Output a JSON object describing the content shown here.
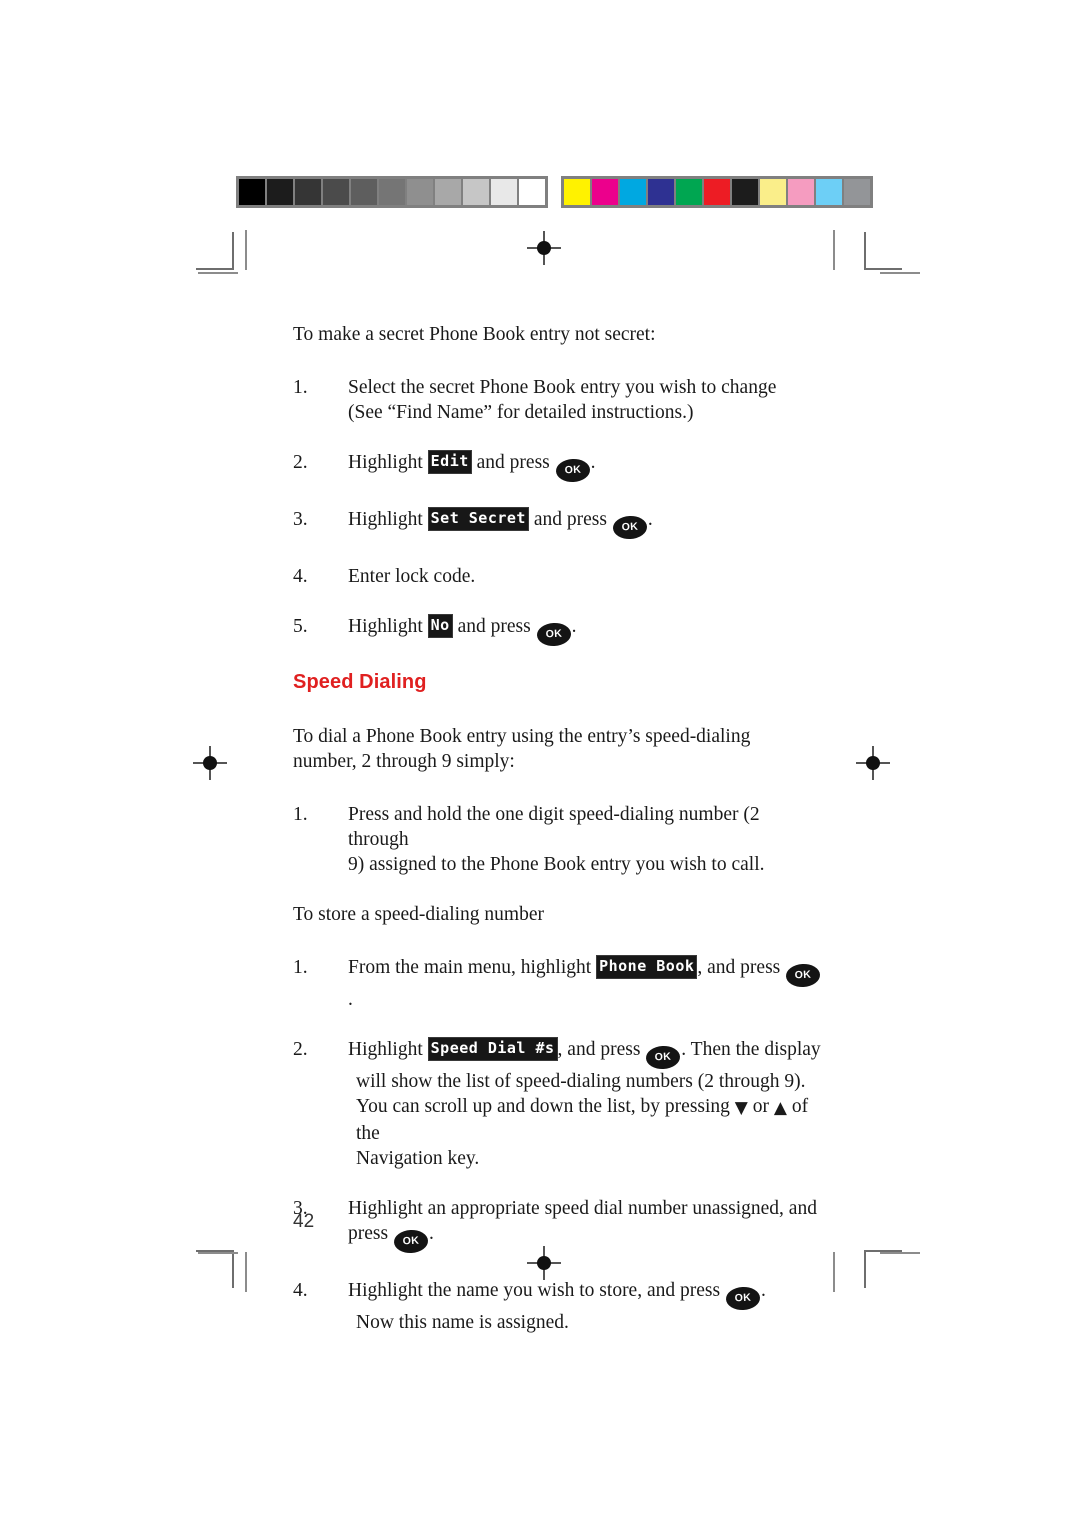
{
  "page": {
    "number": "42",
    "folio_label": "42"
  },
  "calibration": {
    "grayscale_label": "grayscale-calibration-bar",
    "color_label": "color-calibration-bar",
    "grayscale_patches": [
      "#000000",
      "#1c1c1c",
      "#353535",
      "#4b4b4b",
      "#5e5e5e",
      "#757575",
      "#8f8f8f",
      "#a8a8a8",
      "#c6c6c6",
      "#e8e8e8",
      "#ffffff"
    ],
    "color_patches": [
      "#fff200",
      "#ec008c",
      "#00a8e1",
      "#2e3192",
      "#00a651",
      "#ed1c24",
      "#1c1c1c",
      "#faee8a",
      "#f59cc0",
      "#6dcff6",
      "#939598"
    ]
  },
  "body": {
    "intro_secret": "To make a secret Phone Book entry not secret:",
    "steps_secret": [
      {
        "num": "1.",
        "line1": "Select the secret Phone Book entry you wish to change",
        "line2": "(See “Find Name” for detailed instructions.)"
      },
      {
        "num": "2.",
        "pre": "Highlight",
        "lcd": "Edit",
        "mid": "and press",
        "key": "OK",
        "post": "."
      },
      {
        "num": "3.",
        "pre": "Highlight",
        "lcd": "Set Secret",
        "mid": "and press",
        "key": "OK",
        "post": "."
      },
      {
        "num": "4.",
        "line1": "Enter lock code."
      },
      {
        "num": "5.",
        "pre": "Highlight",
        "lcd": "No",
        "mid": "and press",
        "key": "OK",
        "post": "."
      }
    ],
    "heading_speed_dialing": "Speed Dialing",
    "intro_dial_line1": "To dial a Phone Book entry using the entry’s speed-dialing",
    "intro_dial_line2": "number, 2 through 9 simply:",
    "step_dial": {
      "num": "1.",
      "line1": "Press and hold the one digit speed-dialing number (2 through",
      "line2": "9) assigned to the Phone Book entry you wish to call."
    },
    "intro_store": "To store a speed-dialing number",
    "steps_store": [
      {
        "num": "1.",
        "pre": "From the main menu, highlight",
        "lcd": "Phone Book",
        "mid": ", and press",
        "key": "OK",
        "post": "."
      },
      {
        "num": "2.",
        "pre": "Highlight",
        "lcd": "Speed Dial #s",
        "mid": ", and press",
        "key": "OK",
        "post": ". Then the display",
        "line2": "will show the list of speed-dialing numbers (2 through 9).",
        "line3_pre": "You can scroll up and down the list, by pressing",
        "arrow_down": "▼",
        "line3_mid": "or",
        "arrow_up": "▲",
        "line3_post": "of the",
        "line4": "Navigation key."
      },
      {
        "num": "3.",
        "line1": "Highlight an appropriate speed dial number unassigned, and",
        "pre2": "press",
        "key": "OK",
        "post": "."
      },
      {
        "num": "4.",
        "pre": "Highlight the name you wish to store, and press",
        "key": "OK",
        "post": ".",
        "line2": "Now this name is assigned."
      }
    ]
  },
  "colors": {
    "heading_red": "#e02020",
    "text_black": "#1a1a1a",
    "mark_gray": "#6e6e6e"
  }
}
